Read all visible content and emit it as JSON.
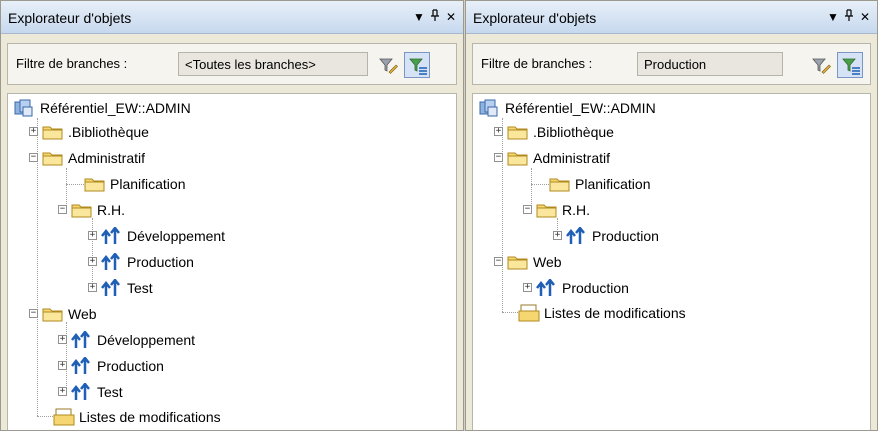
{
  "left": {
    "title": "Explorateur d'objets",
    "filter_label": "Filtre de branches :",
    "filter_value": "<Toutes les branches>",
    "repo": "Référentiel_EW::ADMIN",
    "library": ".Bibliothèque",
    "admin": "Administratif",
    "planning": "Planification",
    "rh": "R.H.",
    "rh_dev": "Développement",
    "rh_prod": "Production",
    "rh_test": "Test",
    "web": "Web",
    "web_dev": "Développement",
    "web_prod": "Production",
    "web_test": "Test",
    "changelists": "Listes de modifications"
  },
  "right": {
    "title": "Explorateur d'objets",
    "filter_label": "Filtre de branches :",
    "filter_value": "Production",
    "repo": "Référentiel_EW::ADMIN",
    "library": ".Bibliothèque",
    "admin": "Administratif",
    "planning": "Planification",
    "rh": "R.H.",
    "rh_prod": "Production",
    "web": "Web",
    "web_prod": "Production",
    "changelists": "Listes de modifications"
  },
  "titlebar_buttons": {
    "dropdown": "▼",
    "pin": "ᛘ",
    "close": "✕"
  },
  "colors": {
    "folder": "#f6d671",
    "branch": "#1f5fb5",
    "accent": "#d6e2f6"
  }
}
